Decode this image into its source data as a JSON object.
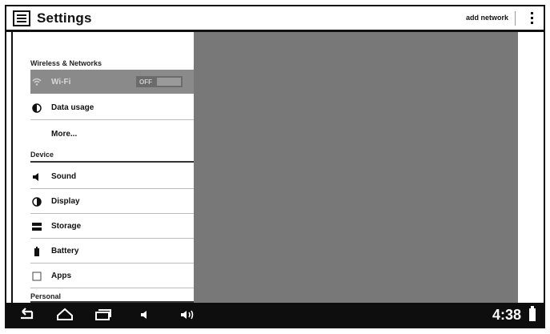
{
  "actionbar": {
    "title": "Settings",
    "add_network": "add network"
  },
  "sections": {
    "wireless": "Wireless & Networks",
    "device": "Device",
    "personal": "Personal"
  },
  "items": {
    "wifi": {
      "label": "Wi-Fi",
      "toggle": "OFF"
    },
    "data_usage": "Data usage",
    "more": "More...",
    "sound": "Sound",
    "display": "Display",
    "storage": "Storage",
    "battery": "Battery",
    "apps": "Apps"
  },
  "statusbar": {
    "time": "4:38"
  }
}
